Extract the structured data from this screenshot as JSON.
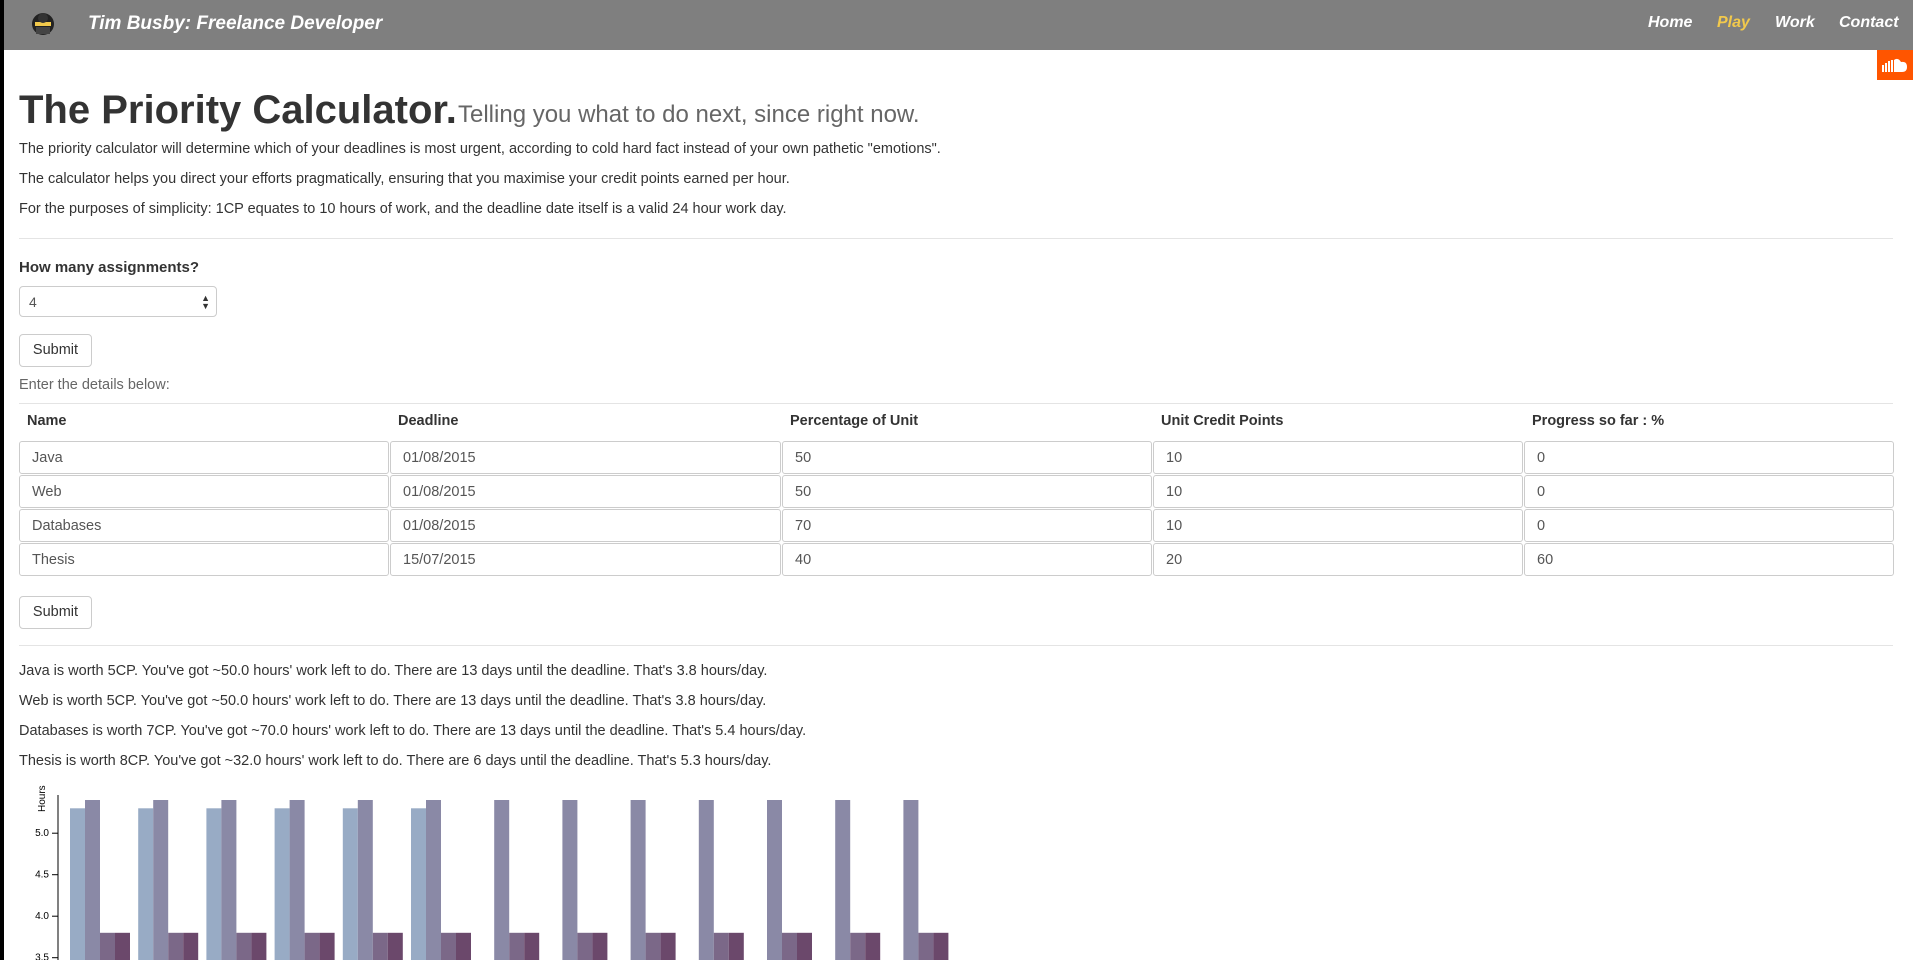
{
  "navbar": {
    "brand": "Tim Busby: Freelance Developer",
    "items": [
      {
        "label": "Home",
        "active": false
      },
      {
        "label": "Play",
        "active": true
      },
      {
        "label": "Work",
        "active": false
      },
      {
        "label": "Contact",
        "active": false
      }
    ],
    "accent_color": "#f2c94c",
    "background": "#7f7f7f"
  },
  "page": {
    "title": "The Priority Calculator.",
    "subtitle": "Telling you what to do next, since right now.",
    "intro": [
      "The priority calculator will determine which of your deadlines is most urgent, according to cold hard fact instead of your own pathetic \"emotions\".",
      "The calculator helps you direct your efforts pragmatically, ensuring that you maximise your credit points earned per hour.",
      "For the purposes of simplicity: 1CP equates to 10 hours of work, and the deadline date itself is a valid 24 hour work day."
    ]
  },
  "form": {
    "count_label": "How many assignments?",
    "count_value": "4",
    "submit_label": "Submit",
    "details_hint": "Enter the details below:"
  },
  "table": {
    "headers": [
      "Name",
      "Deadline",
      "Percentage of Unit",
      "Unit Credit Points",
      "Progress so far : %"
    ],
    "rows": [
      [
        "Java",
        "01/08/2015",
        "50",
        "10",
        "0"
      ],
      [
        "Web",
        "01/08/2015",
        "50",
        "10",
        "0"
      ],
      [
        "Databases",
        "01/08/2015",
        "70",
        "10",
        "0"
      ],
      [
        "Thesis",
        "15/07/2015",
        "40",
        "20",
        "60"
      ]
    ],
    "submit_label": "Submit"
  },
  "results": [
    "Java is worth 5CP. You've got ~50.0 hours' work left to do. There are 13 days until the deadline. That's 3.8 hours/day.",
    "Web is worth 5CP. You've got ~50.0 hours' work left to do. There are 13 days until the deadline. That's 3.8 hours/day.",
    "Databases is worth 7CP. You've got ~70.0 hours' work left to do. There are 13 days until the deadline. That's 5.4 hours/day.",
    "Thesis is worth 8CP. You've got ~32.0 hours' work left to do. There are 6 days until the deadline. That's 5.3 hours/day."
  ],
  "chart_data": {
    "type": "bar",
    "ylabel": "Hours",
    "yticks": [
      "5.0",
      "4.5",
      "4.0",
      "3.5"
    ],
    "ylim": [
      3.5,
      5.4
    ],
    "groups": 13,
    "series": [
      {
        "color": "#98abc5",
        "values": [
          5.3,
          5.3,
          5.3,
          5.3,
          5.3,
          5.3,
          null,
          null,
          null,
          null,
          null,
          null,
          null
        ]
      },
      {
        "color": "#8a89a6",
        "values": [
          5.4,
          5.4,
          5.4,
          5.4,
          5.4,
          5.4,
          5.4,
          5.4,
          5.4,
          5.4,
          5.4,
          5.4,
          5.4
        ]
      },
      {
        "color": "#7b6888",
        "values": [
          3.8,
          3.8,
          3.8,
          3.8,
          3.8,
          3.8,
          3.8,
          3.8,
          3.8,
          3.8,
          3.8,
          3.8,
          3.8
        ]
      },
      {
        "color": "#6b486b",
        "values": [
          3.8,
          3.8,
          3.8,
          3.8,
          3.8,
          3.8,
          3.8,
          3.8,
          3.8,
          3.8,
          3.8,
          3.8,
          3.8
        ]
      }
    ]
  },
  "icons": {
    "logo": "avatar-logo-icon",
    "soundcloud": "soundcloud-icon",
    "select_arrows": "select-arrows-icon"
  }
}
